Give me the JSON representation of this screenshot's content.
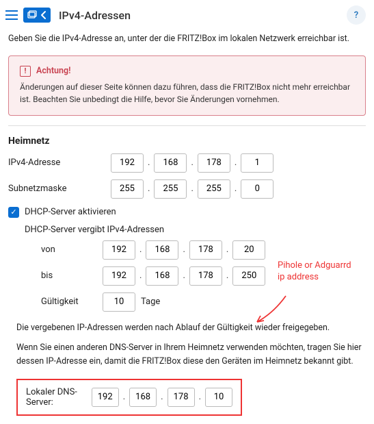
{
  "header": {
    "title": "IPv4-Adressen",
    "help": "?"
  },
  "intro": "Geben Sie die IPv4-Adresse an, unter der die FRITZ!Box im lokalen Netzwerk erreichbar ist.",
  "warning": {
    "title": "Achtung!",
    "body": "Änderungen auf dieser Seite können dazu führen, dass die FRITZ!Box nicht mehr erreichbar ist. Beachten Sie unbedingt die Hilfe, bevor Sie Änderungen vornehmen."
  },
  "section": "Heimnetz",
  "labels": {
    "ipv4": "IPv4-Adresse",
    "subnet": "Subnetzmaske",
    "dhcp_enable": "DHCP-Server aktivieren",
    "dhcp_head": "DHCP-Server vergibt IPv4-Adressen",
    "from": "von",
    "to": "bis",
    "validity": "Gültigkeit",
    "days": "Tage",
    "dns": "Lokaler DNS-Server:"
  },
  "ip": {
    "o1": "192",
    "o2": "168",
    "o3": "178",
    "o4": "1"
  },
  "mask": {
    "o1": "255",
    "o2": "255",
    "o3": "255",
    "o4": "0"
  },
  "from": {
    "o1": "192",
    "o2": "168",
    "o3": "178",
    "o4": "20"
  },
  "to": {
    "o1": "192",
    "o2": "168",
    "o3": "178",
    "o4": "250"
  },
  "validity": "10",
  "dns": {
    "o1": "192",
    "o2": "168",
    "o3": "178",
    "o4": "10"
  },
  "desc1": "Die vergebenen IP-Adressen werden nach Ablauf der Gültigkeit wieder freigegeben.",
  "desc2": "Wenn Sie einen anderen DNS-Server in Ihrem Heimnetz verwenden möchten, tragen Sie hier dessen IP-Adresse ein, damit die FRITZ!Box diese den Geräten im Heimnetz bekannt gibt.",
  "annotation": "Pihole or Adguarrd ip address"
}
